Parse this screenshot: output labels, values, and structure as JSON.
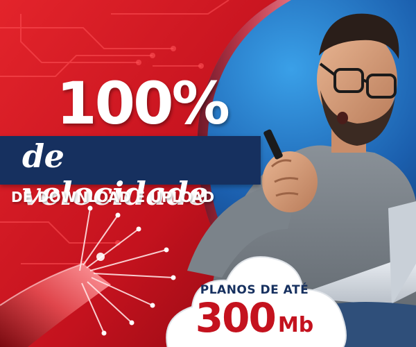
{
  "headline": {
    "percent": "100%",
    "subtitle": "de velocidade",
    "caption": "DE DOWNLOAD E UPLOAD"
  },
  "plan": {
    "label": "PLANOS DE ATÉ",
    "speed_value": "300",
    "speed_unit": "Mb"
  },
  "colors": {
    "brand_red": "#c4121e",
    "brand_navy": "#16305f",
    "white": "#ffffff"
  },
  "icons": {
    "fiber_cable": "fiber-optic-cable-illustration",
    "cloud": "cloud-shape"
  }
}
